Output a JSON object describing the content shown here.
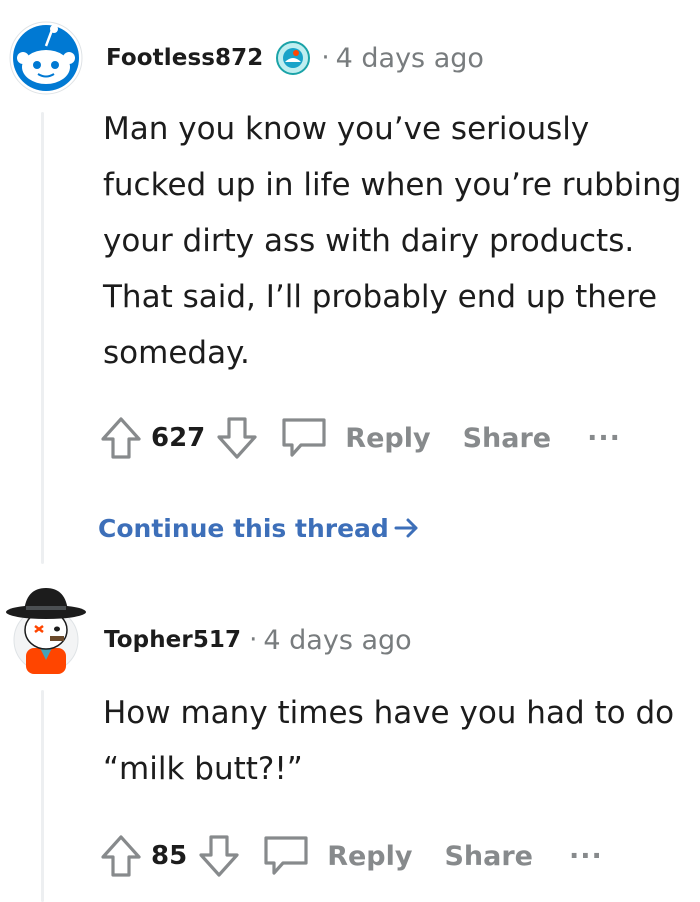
{
  "comments": [
    {
      "username": "Footless872",
      "separator": "·",
      "timestamp": "4 days ago",
      "body": "Man you know you’ve seriously fucked up in life when you’re rubbing your dirty ass with dairy products. That said, I’ll probably end up there someday.",
      "vote_count": "627",
      "reply_label": "Reply",
      "share_label": "Share",
      "more_label": "···",
      "continue_label": "Continue this thread",
      "continue_icon": "arrow-right-icon",
      "avatar_icon": "reddit-snoo-avatar-icon",
      "badge_icon": "achievement-badge-icon"
    },
    {
      "username": "Topher517",
      "separator": "·",
      "timestamp": "4 days ago",
      "body": "How many times have you had to do “milk butt?!”",
      "vote_count": "85",
      "reply_label": "Reply",
      "share_label": "Share",
      "more_label": "···",
      "avatar_icon": "snoo-cowboy-avatar-icon"
    }
  ],
  "colors": {
    "link": "#3d6fb9",
    "muted": "#878a8c",
    "text": "#1c1c1c",
    "thread_line": "#edeff1"
  }
}
